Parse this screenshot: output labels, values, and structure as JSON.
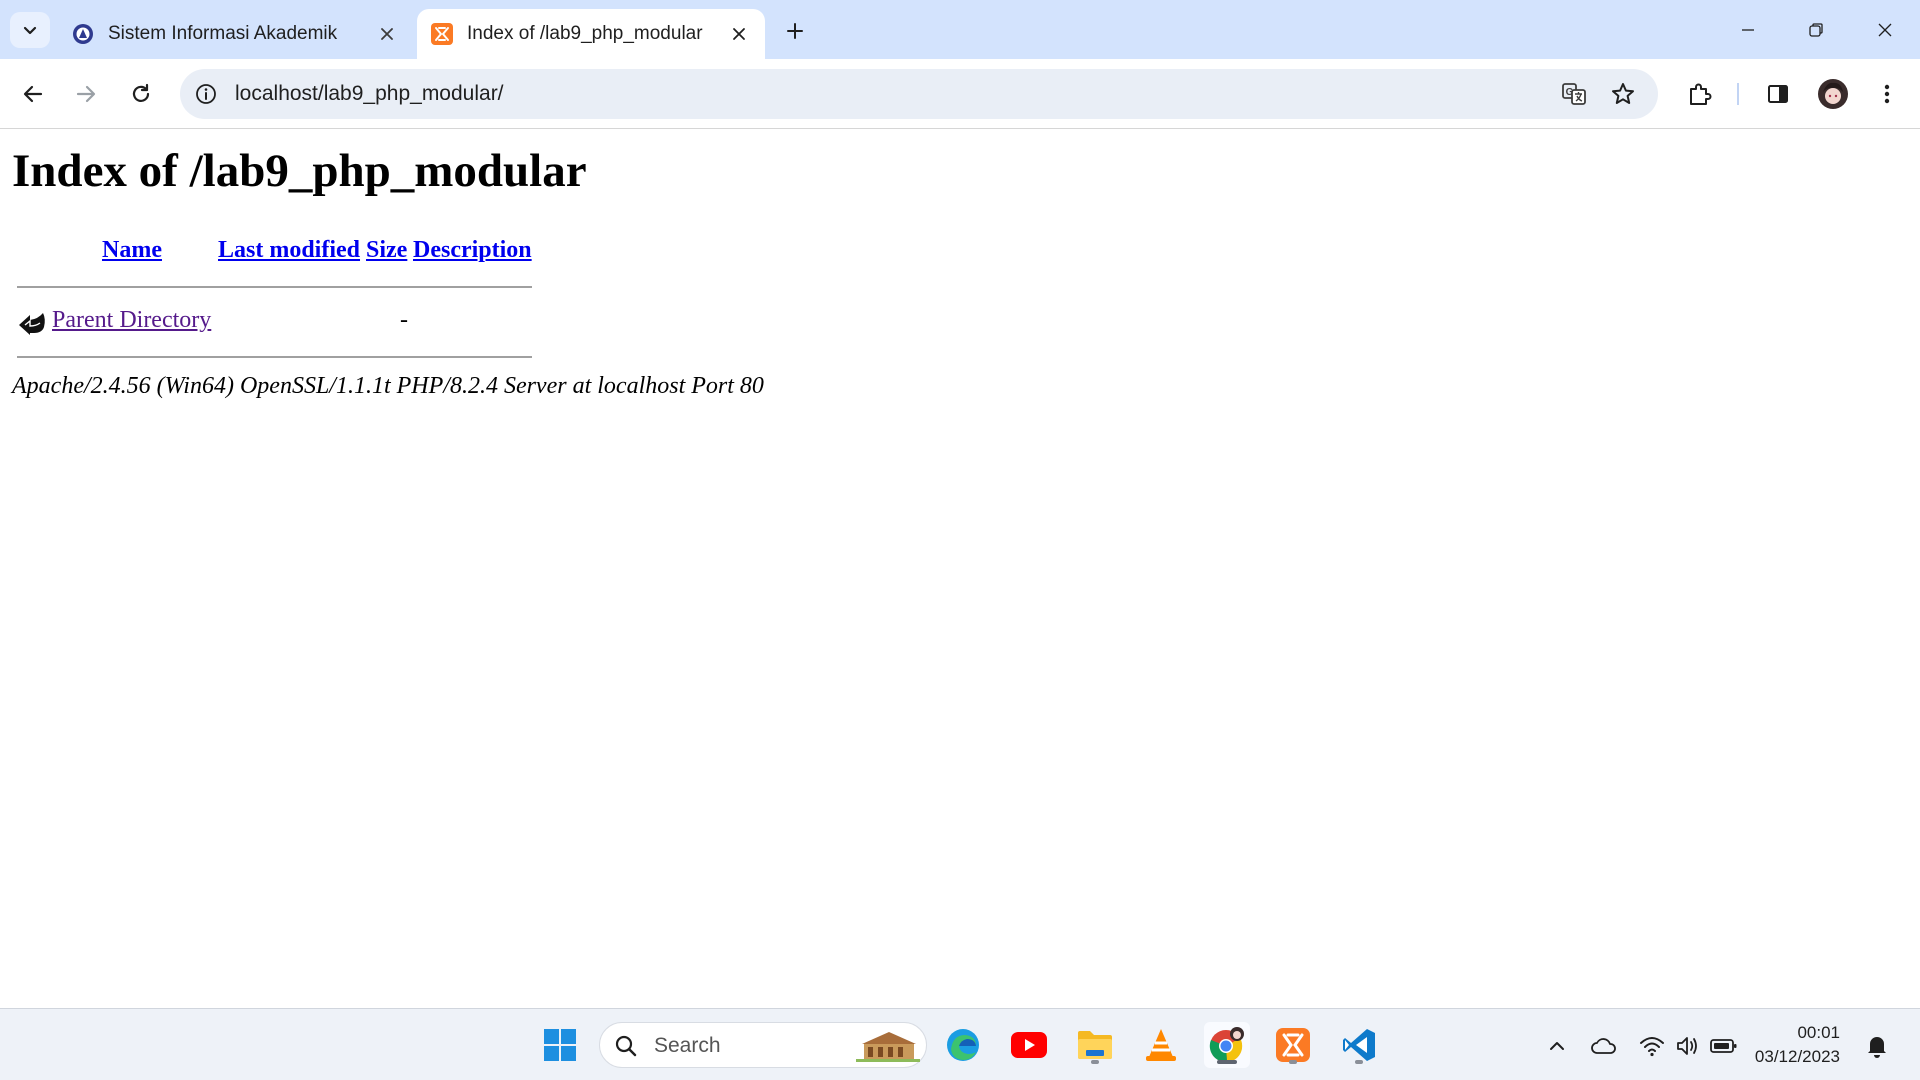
{
  "browser": {
    "tabs": [
      {
        "title": "Sistem Informasi Akademik",
        "favicon": "university-seal-icon",
        "active": false
      },
      {
        "title": "Index of /lab9_php_modular",
        "favicon": "xampp-icon",
        "active": true
      }
    ],
    "url": "localhost/lab9_php_modular/"
  },
  "page": {
    "heading": "Index of /lab9_php_modular",
    "columns": [
      "Name",
      "Last modified",
      "Size",
      "Description"
    ],
    "rows": [
      {
        "name": "Parent Directory",
        "last_modified": "",
        "size": "-",
        "description": "",
        "icon": "back-arrow-icon"
      }
    ],
    "address": "Apache/2.4.56 (Win64) OpenSSL/1.1.1t PHP/8.2.4 Server at localhost Port 80"
  },
  "taskbar": {
    "search_label": "Search",
    "apps": [
      "windows-start",
      "edge",
      "youtube",
      "file-explorer",
      "vlc",
      "chrome",
      "xampp",
      "vscode"
    ],
    "time": "00:01",
    "date": "03/12/2023"
  },
  "colors": {
    "tabstrip": "#d3e3fd",
    "omnibox": "#e9eef6",
    "link": "#0000ee",
    "visited_link": "#551a8b"
  }
}
